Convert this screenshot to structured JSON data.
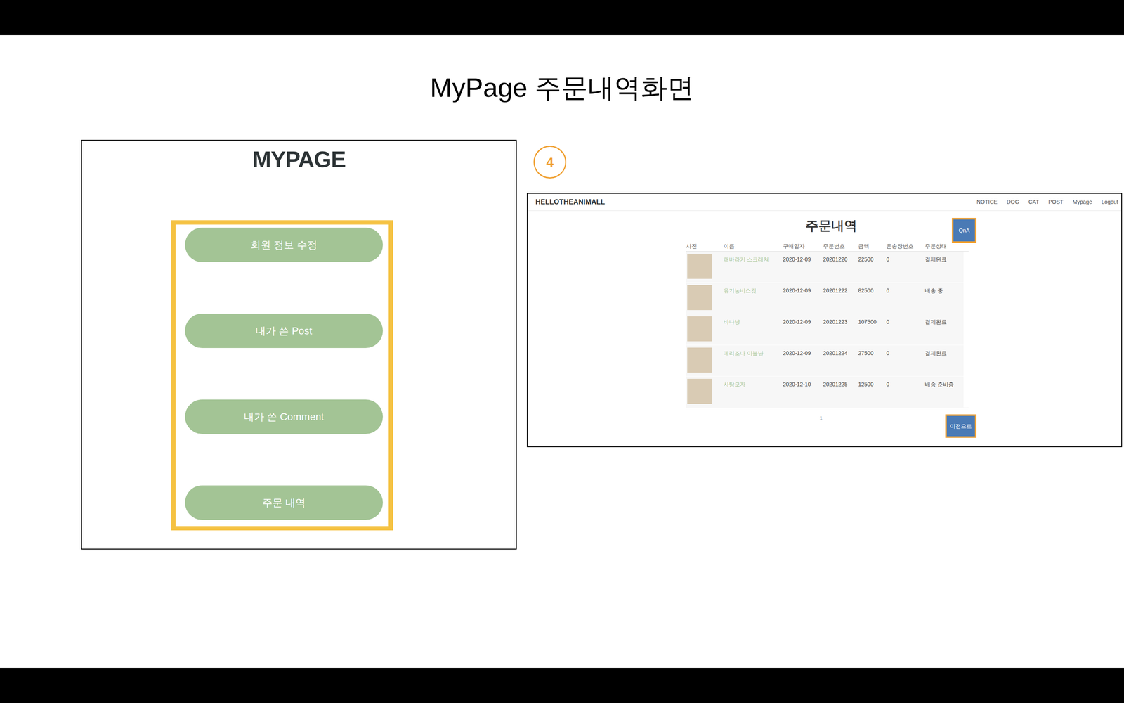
{
  "slide": {
    "title": "MyPage 주문내역화면"
  },
  "mypage": {
    "heading": "MYPAGE",
    "menu": [
      "회원 정보 수정",
      "내가 쓴 Post",
      "내가 쓴 Comment",
      "주문 내역"
    ]
  },
  "step": {
    "number": "4"
  },
  "screen": {
    "brand": "HELLOTHEANIMALL",
    "nav": [
      "NOTICE",
      "DOG",
      "CAT",
      "POST",
      "Mypage",
      "Logout"
    ],
    "title": "주문내역",
    "qna_button": "QnA",
    "columns": [
      "사진",
      "이름",
      "구매일자",
      "주문번호",
      "금액",
      "운송장번호",
      "주문상태"
    ],
    "rows": [
      {
        "name": "해바라기 스크래쳐",
        "date": "2020-12-09",
        "order_no": "20201220",
        "price": "22500",
        "tracking": "0",
        "status": "결제완료"
      },
      {
        "name": "유기농비스킷",
        "date": "2020-12-09",
        "order_no": "20201222",
        "price": "82500",
        "tracking": "0",
        "status": "배송 중"
      },
      {
        "name": "바나냥",
        "date": "2020-12-09",
        "order_no": "20201223",
        "price": "107500",
        "tracking": "0",
        "status": "결제완료"
      },
      {
        "name": "메리조나 이불냥",
        "date": "2020-12-09",
        "order_no": "20201224",
        "price": "27500",
        "tracking": "0",
        "status": "결제완료"
      },
      {
        "name": "사탕모자",
        "date": "2020-12-10",
        "order_no": "20201225",
        "price": "12500",
        "tracking": "0",
        "status": "배송 준비중"
      }
    ],
    "pages": [
      "1"
    ],
    "back_button": "이전으로"
  }
}
